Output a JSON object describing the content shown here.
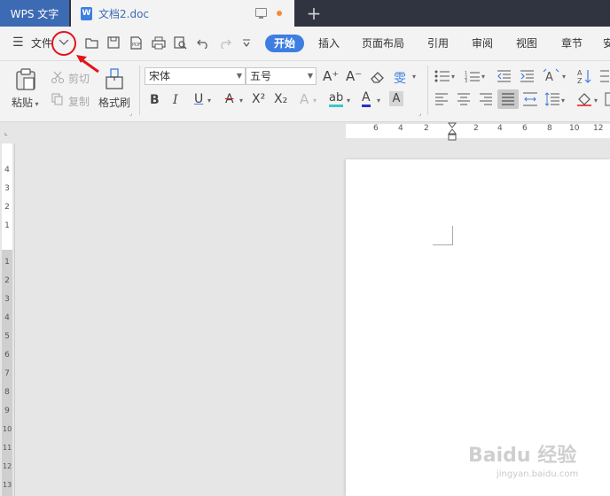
{
  "tabs": {
    "app_label": "WPS 文字",
    "doc_title": "文档2.doc",
    "doc_icon": "W",
    "add_label": "+"
  },
  "menubar": {
    "hamburger": "☰",
    "file_label": "文件",
    "items": [
      "开始",
      "插入",
      "页面布局",
      "引用",
      "审阅",
      "视图",
      "章节",
      "安"
    ],
    "active": "开始"
  },
  "ribbon": {
    "paste": "粘贴",
    "cut": "剪切",
    "copy": "复制",
    "format_painter": "格式刷",
    "font_name": "宋体",
    "font_size": "五号",
    "bold": "B",
    "italic": "I",
    "underline": "U",
    "strike": "A",
    "superscript": "X²",
    "subscript": "X₂",
    "font_color": "A",
    "highlight": "ab",
    "char_shade": "A",
    "grow": "A⁺",
    "shrink": "A⁻",
    "phonetic": "雯"
  },
  "ruler": {
    "h_ticks": [
      "6",
      "4",
      "2",
      "2",
      "4",
      "6",
      "8",
      "10",
      "12"
    ],
    "v_ticks": [
      "4",
      "3",
      "2",
      "1",
      "1",
      "2",
      "3",
      "4",
      "5",
      "6",
      "7",
      "8",
      "9",
      "10",
      "11",
      "12",
      "13"
    ]
  },
  "watermark": {
    "text": "Baidu 经验",
    "sub": "jingyan.baidu.com"
  },
  "colors": {
    "accent": "#3d7ee0",
    "tabbar": "#2f3440",
    "annotation": "#e3141b"
  }
}
